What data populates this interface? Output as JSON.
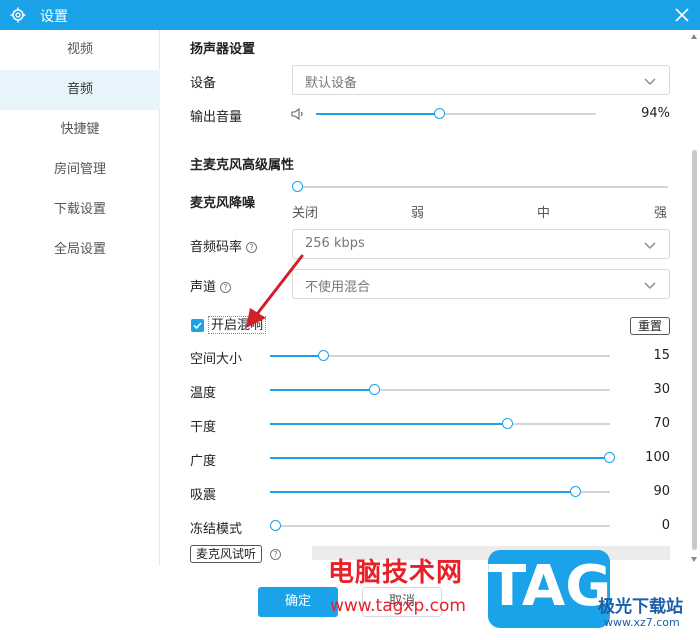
{
  "window": {
    "title": "设置"
  },
  "sidebar": {
    "items": [
      {
        "label": "视频"
      },
      {
        "label": "音频"
      },
      {
        "label": "快捷键"
      },
      {
        "label": "房间管理"
      },
      {
        "label": "下载设置"
      },
      {
        "label": "全局设置"
      }
    ],
    "active": 1
  },
  "speaker": {
    "section_title": "扬声器设置",
    "device_label": "设备",
    "device_value": "默认设备",
    "volume_label": "输出音量",
    "volume_value": "94%",
    "volume_level": 0.44
  },
  "mic": {
    "section_title": "主麦克风高级属性",
    "noise_label": "麦克风降噪",
    "noise_ticks": [
      "关闭",
      "弱",
      "中",
      "强"
    ],
    "noise_level": 0,
    "bitrate_label": "音频码率",
    "bitrate_value": "256 kbps",
    "channel_label": "声道",
    "channel_value": "不使用混合"
  },
  "reverb": {
    "enable_label": "开启混响",
    "enabled": true,
    "reset_label": "重置",
    "params": [
      {
        "label": "空间大小",
        "value": "15",
        "level": 0.16
      },
      {
        "label": "温度",
        "value": "30",
        "level": 0.31
      },
      {
        "label": "干度",
        "value": "70",
        "level": 0.7
      },
      {
        "label": "广度",
        "value": "100",
        "level": 1.0
      },
      {
        "label": "吸震",
        "value": "90",
        "level": 0.9
      },
      {
        "label": "冻结模式",
        "value": "0",
        "level": 0.0
      }
    ]
  },
  "mic_test_label": "麦克风试听",
  "footer": {
    "ok_label": "确定",
    "cancel_label": "取消"
  },
  "watermark": {
    "site_name": "电脑技术网",
    "site_url": "www.tagxp.com",
    "logo_text": "TAG",
    "partner_name": "极光下载站",
    "partner_url": "www.xz7.com"
  },
  "colors": {
    "accent": "#1aa3e8",
    "arrow": "#d0202a"
  }
}
